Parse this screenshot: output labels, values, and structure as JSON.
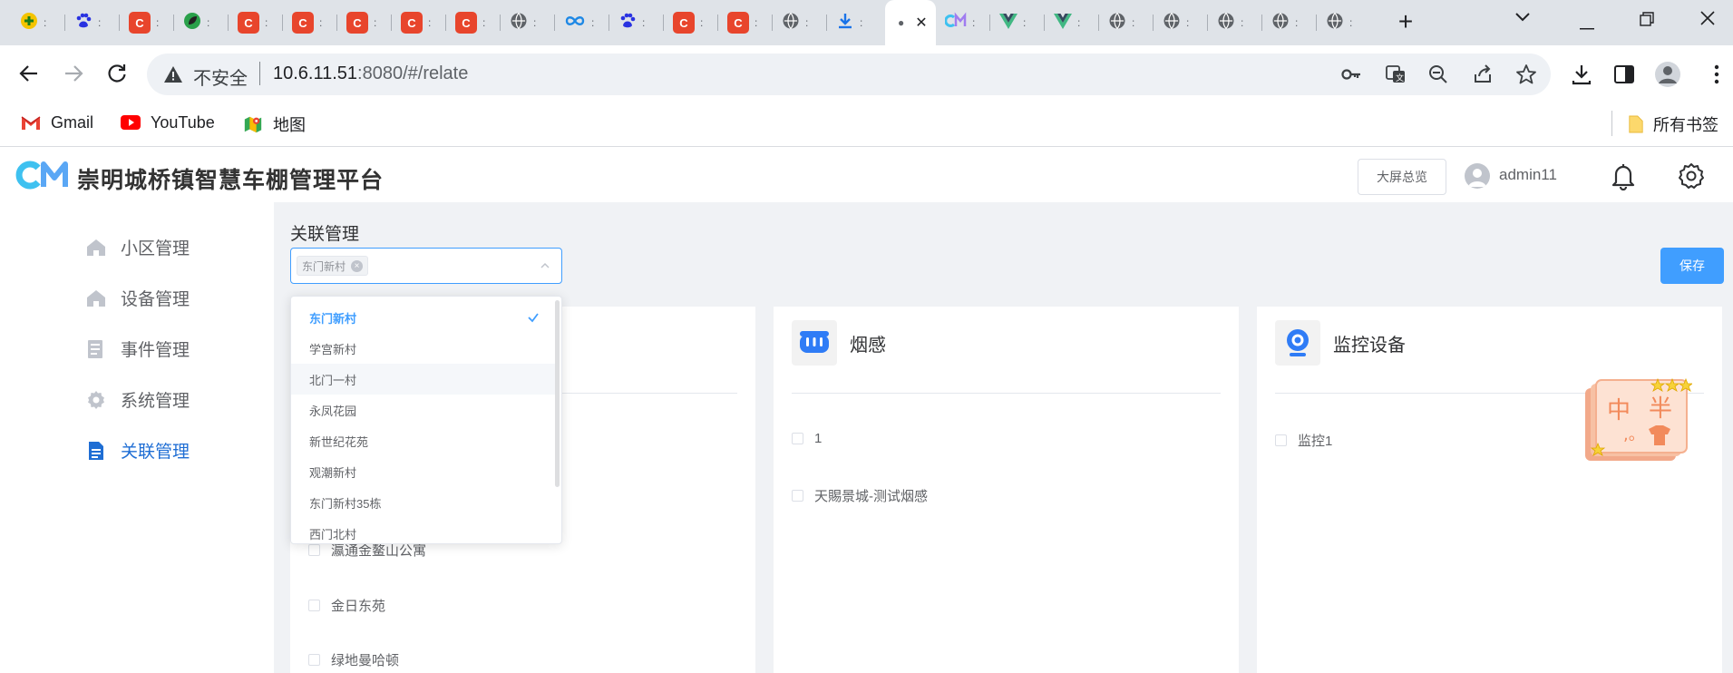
{
  "browser": {
    "tabs": [
      {
        "icon": "plus-circle",
        "color": "#f4c400"
      },
      {
        "icon": "paw",
        "color": "#2932e1"
      },
      {
        "icon": "c",
        "color": "#e8452c"
      },
      {
        "icon": "leaf",
        "color": "#2aa04a"
      },
      {
        "icon": "c",
        "color": "#e8452c"
      },
      {
        "icon": "c",
        "color": "#e8452c"
      },
      {
        "icon": "c",
        "color": "#e8452c"
      },
      {
        "icon": "c",
        "color": "#e8452c"
      },
      {
        "icon": "c",
        "color": "#e8452c"
      },
      {
        "icon": "globe",
        "color": "#5f6368"
      },
      {
        "icon": "infinity",
        "color": "#1e88e5"
      },
      {
        "icon": "paw",
        "color": "#2932e1"
      },
      {
        "icon": "c",
        "color": "#e8452c"
      },
      {
        "icon": "c",
        "color": "#e8452c"
      },
      {
        "icon": "globe",
        "color": "#5f6368"
      },
      {
        "icon": "download",
        "color": "#1a73e8"
      },
      {
        "icon": "active",
        "color": "#ffffff"
      },
      {
        "icon": "cm-logo",
        "color": "#3ec1f0"
      },
      {
        "icon": "vue",
        "color": "#41b883"
      },
      {
        "icon": "vue",
        "color": "#41b883"
      },
      {
        "icon": "globe",
        "color": "#5f6368"
      },
      {
        "icon": "globe",
        "color": "#5f6368"
      },
      {
        "icon": "globe",
        "color": "#5f6368"
      },
      {
        "icon": "globe",
        "color": "#5f6368"
      },
      {
        "icon": "globe",
        "color": "#5f6368"
      }
    ],
    "insecure_label": "不安全",
    "url_host": "10.6.11.51",
    "url_rest": ":8080/#/relate",
    "bookmarks": [
      {
        "label": "Gmail",
        "icon": "gmail-icon"
      },
      {
        "label": "YouTube",
        "icon": "youtube-icon"
      },
      {
        "label": "地图",
        "icon": "maps-icon"
      }
    ],
    "all_bookmarks_label": "所有书签"
  },
  "header": {
    "logo_text": "CM",
    "title": "崇明城桥镇智慧车棚管理平台",
    "bigscreen_label": "大屏总览",
    "username": "admin11"
  },
  "sidebar": {
    "items": [
      {
        "label": "小区管理",
        "icon": "home-icon",
        "active": false
      },
      {
        "label": "设备管理",
        "icon": "home-icon",
        "active": false
      },
      {
        "label": "事件管理",
        "icon": "list-icon",
        "active": false
      },
      {
        "label": "系统管理",
        "icon": "gear-icon",
        "active": false
      },
      {
        "label": "关联管理",
        "icon": "document-icon",
        "active": true
      }
    ]
  },
  "main": {
    "section_label": "关联管理",
    "selected_tag": "东门新村",
    "save_label": "保存",
    "dropdown_options": [
      "东门新村",
      "学宫新村",
      "北门一村",
      "永凤花园",
      "新世纪花苑",
      "观潮新村",
      "东门新村35栋",
      "西门北村"
    ],
    "dropdown_selected_index": 0,
    "dropdown_hover_index": 2,
    "community_list": [
      "瀛通金鳌山公寓",
      "金日东苑",
      "绿地曼哈顿"
    ],
    "smoke": {
      "title": "烟感",
      "items": [
        "1",
        "天賜景城-测试烟感"
      ]
    },
    "camera": {
      "title": "监控设备",
      "items": [
        "监控1"
      ]
    },
    "accent": "#409eff"
  }
}
